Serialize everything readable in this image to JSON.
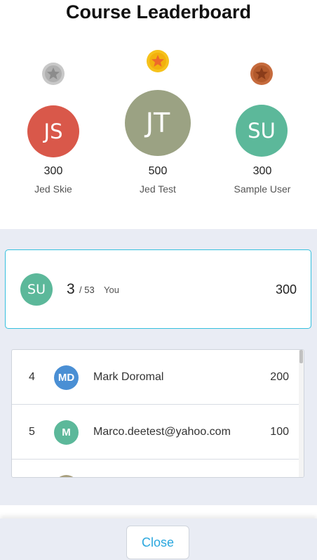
{
  "title": "Course Leaderboard",
  "podium": [
    {
      "position": "second",
      "initials": "JS",
      "score": "300",
      "name": "Jed Skie",
      "avatar_color": "#d9584a",
      "medal": "silver-medal-icon"
    },
    {
      "position": "first",
      "initials": "JT",
      "score": "500",
      "name": "Jed Test",
      "avatar_color": "#9ba283",
      "medal": "gold-medal-icon"
    },
    {
      "position": "third",
      "initials": "SU",
      "score": "300",
      "name": "Sample User",
      "avatar_color": "#5cb89a",
      "medal": "bronze-medal-icon"
    }
  ],
  "you": {
    "initials": "SU",
    "rank": "3",
    "total": "/ 53",
    "label": "You",
    "score": "300",
    "avatar_color": "#5cb89a"
  },
  "list": [
    {
      "rank": "4",
      "initials": "MD",
      "name": "Mark Doromal",
      "score": "200",
      "avatar_color": "#4a8fd4"
    },
    {
      "rank": "5",
      "initials": "M",
      "name": "Marco.deetest@yahoo.com",
      "score": "100",
      "avatar_color": "#5cb89a"
    }
  ],
  "footer": {
    "close_label": "Close"
  },
  "colors": {
    "accent": "#35c0de",
    "panel": "#e9ecf4"
  }
}
